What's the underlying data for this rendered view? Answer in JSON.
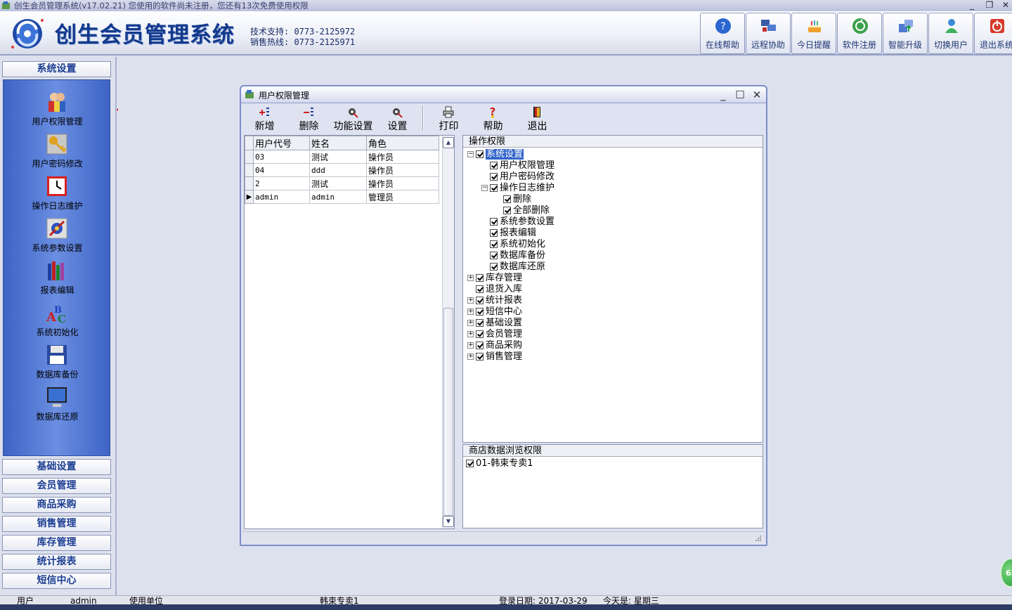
{
  "window": {
    "title": "创生会员管理系统(v17.02.21)  您使用的软件尚未注册，您还有13次免费使用权限",
    "controls": [
      "minimize",
      "restore",
      "close"
    ]
  },
  "header": {
    "brand": "创生会员管理系统",
    "support_line": "技术支持: 0773-2125972",
    "sales_line": "销售热线: 0773-2125971",
    "buttons": [
      {
        "label": "在线帮助",
        "icon": "help-icon"
      },
      {
        "label": "远程协助",
        "icon": "remote-icon"
      },
      {
        "label": "今日提醒",
        "icon": "cake-icon"
      },
      {
        "label": "软件注册",
        "icon": "register-icon"
      },
      {
        "label": "智能升级",
        "icon": "upgrade-icon"
      },
      {
        "label": "切换用户",
        "icon": "switch-user-icon"
      },
      {
        "label": "退出系统",
        "icon": "exit-icon"
      }
    ]
  },
  "sidebar": {
    "active_section": "系统设置",
    "items": [
      {
        "label": "用户权限管理",
        "icon": "users-icon"
      },
      {
        "label": "用户密码修改",
        "icon": "key-icon"
      },
      {
        "label": "操作日志维护",
        "icon": "clock-icon"
      },
      {
        "label": "系统参数设置",
        "icon": "tools-icon"
      },
      {
        "label": "报表编辑",
        "icon": "books-icon"
      },
      {
        "label": "系统初始化",
        "icon": "abc-icon"
      },
      {
        "label": "数据库备份",
        "icon": "floppy-icon"
      },
      {
        "label": "数据库还原",
        "icon": "monitor-icon"
      }
    ],
    "sections": [
      "基础设置",
      "会员管理",
      "商品采购",
      "销售管理",
      "库存管理",
      "统计报表",
      "短信中心"
    ]
  },
  "dialog": {
    "title": "用户权限管理",
    "toolbar": [
      {
        "label": "新增",
        "icon": "add-icon"
      },
      {
        "label": "删除",
        "icon": "delete-icon"
      },
      {
        "label": "功能设置",
        "icon": "function-settings-icon"
      },
      {
        "label": "设置",
        "icon": "settings-icon"
      },
      {
        "label": "打印",
        "icon": "print-icon"
      },
      {
        "label": "帮助",
        "icon": "help-icon"
      },
      {
        "label": "退出",
        "icon": "exit-door-icon"
      }
    ],
    "grid": {
      "columns": [
        "用户代号",
        "姓名",
        "角色"
      ],
      "rows": [
        {
          "code": "03",
          "name": "测试",
          "role": "操作员"
        },
        {
          "code": "04",
          "name": "ddd",
          "role": "操作员"
        },
        {
          "code": "2",
          "name": "测试",
          "role": "操作员"
        },
        {
          "code": "admin",
          "name": "admin",
          "role": "管理员"
        }
      ],
      "current_row": 3
    },
    "permissions": {
      "header": "操作权限",
      "tree": [
        {
          "label": "系统设置",
          "depth": 0,
          "toggle": "-",
          "checked": true,
          "selected": true
        },
        {
          "label": "用户权限管理",
          "depth": 1,
          "toggle": "",
          "checked": true
        },
        {
          "label": "用户密码修改",
          "depth": 1,
          "toggle": "",
          "checked": true
        },
        {
          "label": "操作日志维护",
          "depth": 1,
          "toggle": "-",
          "checked": true
        },
        {
          "label": "删除",
          "depth": 2,
          "toggle": "",
          "checked": true
        },
        {
          "label": "全部删除",
          "depth": 2,
          "toggle": "",
          "checked": true
        },
        {
          "label": "系统参数设置",
          "depth": 1,
          "toggle": "",
          "checked": true
        },
        {
          "label": "报表编辑",
          "depth": 1,
          "toggle": "",
          "checked": true
        },
        {
          "label": "系统初始化",
          "depth": 1,
          "toggle": "",
          "checked": true
        },
        {
          "label": "数据库备份",
          "depth": 1,
          "toggle": "",
          "checked": true
        },
        {
          "label": "数据库还原",
          "depth": 1,
          "toggle": "",
          "checked": true
        },
        {
          "label": "库存管理",
          "depth": 0,
          "toggle": "+",
          "checked": true
        },
        {
          "label": "退货入库",
          "depth": 0,
          "toggle": "",
          "checked": true
        },
        {
          "label": "统计报表",
          "depth": 0,
          "toggle": "+",
          "checked": true
        },
        {
          "label": "短信中心",
          "depth": 0,
          "toggle": "+",
          "checked": true
        },
        {
          "label": "基础设置",
          "depth": 0,
          "toggle": "+",
          "checked": true
        },
        {
          "label": "会员管理",
          "depth": 0,
          "toggle": "+",
          "checked": true
        },
        {
          "label": "商品采购",
          "depth": 0,
          "toggle": "+",
          "checked": true
        },
        {
          "label": "销售管理",
          "depth": 0,
          "toggle": "+",
          "checked": true
        }
      ]
    },
    "shop_permissions": {
      "header": "商店数据浏览权限",
      "items": [
        {
          "label": "01-韩束专卖1",
          "checked": true
        }
      ]
    }
  },
  "statusbar": {
    "user_label": "用户",
    "user_value": "admin",
    "unit_label": "使用单位",
    "unit_value": "韩束专卖1",
    "login_date": "登录日期: 2017-03-29",
    "weekday": "今天是: 星期三"
  },
  "badge": {
    "value": "63"
  },
  "colors": {
    "sidebar_panel": "#4f76d6",
    "brand_text": "#123a8c",
    "selection": "#3163c9",
    "background": "#dde1ee"
  }
}
